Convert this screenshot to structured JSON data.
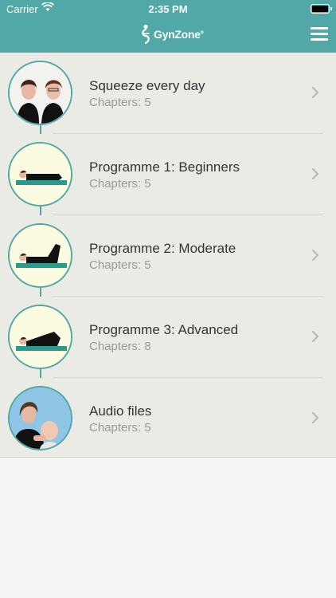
{
  "status_bar": {
    "carrier": "Carrier",
    "time": "2:35 PM"
  },
  "header": {
    "logo_text": "GynZone",
    "logo_mark": "®",
    "menu_icon": "hamburger-menu-icon"
  },
  "colors": {
    "accent": "#52a8a6",
    "list_bg": "#ebebe6",
    "page_bg": "#f5f5f3"
  },
  "programmes": [
    {
      "title": "Squeeze every day",
      "chapters": "Chapters: 5",
      "image": "two-women-portrait"
    },
    {
      "title": "Programme 1: Beginners",
      "chapters": "Chapters: 5",
      "image": "woman-lying-on-mat"
    },
    {
      "title": "Programme 2: Moderate",
      "chapters": "Chapters: 5",
      "image": "woman-lying-knees-up"
    },
    {
      "title": "Programme 3: Advanced",
      "chapters": "Chapters: 8",
      "image": "woman-lying-bridge"
    },
    {
      "title": "Audio files",
      "chapters": "Chapters: 5",
      "image": "mother-with-baby"
    }
  ]
}
